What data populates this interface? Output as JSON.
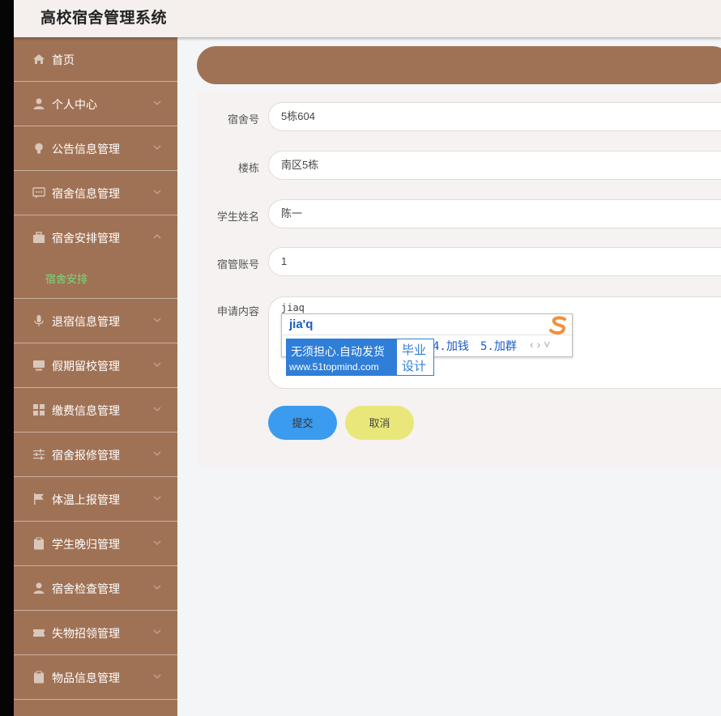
{
  "app": {
    "title": "高校宿舍管理系统"
  },
  "sidebar": {
    "items": [
      {
        "label": "首页",
        "icon": "home-icon",
        "chevron": false
      },
      {
        "label": "个人中心",
        "icon": "user-icon",
        "chevron": true
      },
      {
        "label": "公告信息管理",
        "icon": "bulb-icon",
        "chevron": true
      },
      {
        "label": "宿舍信息管理",
        "icon": "chat-icon",
        "chevron": true
      },
      {
        "label": "宿舍安排管理",
        "icon": "briefcase-icon",
        "chevron": true,
        "expanded": true
      },
      {
        "label": "退宿信息管理",
        "icon": "microphone-icon",
        "chevron": true
      },
      {
        "label": "假期留校管理",
        "icon": "monitor-icon",
        "chevron": true
      },
      {
        "label": "缴费信息管理",
        "icon": "grid-icon",
        "chevron": true
      },
      {
        "label": "宿舍报修管理",
        "icon": "sliders-icon",
        "chevron": true
      },
      {
        "label": "体温上报管理",
        "icon": "flag-icon",
        "chevron": true
      },
      {
        "label": "学生晚归管理",
        "icon": "clipboard-icon",
        "chevron": true
      },
      {
        "label": "宿舍检查管理",
        "icon": "user-icon",
        "chevron": true
      },
      {
        "label": "失物招领管理",
        "icon": "ticket-icon",
        "chevron": true
      },
      {
        "label": "物品信息管理",
        "icon": "clipboard-icon",
        "chevron": true
      }
    ],
    "sub_item": "宿舍安排",
    "accent_color": "#a07255",
    "active_color": "#7dd97a"
  },
  "form": {
    "dorm_no_label": "宿舍号",
    "dorm_no_value": "5栋604",
    "building_label": "楼栋",
    "building_value": "南区5栋",
    "student_label": "学生姓名",
    "student_value": "陈一",
    "manager_label": "宿管账号",
    "manager_value": "1",
    "content_label": "申请内容",
    "content_value": "jiaq",
    "submit_label": "提交",
    "cancel_label": "取消"
  },
  "ime": {
    "input": "jia'q",
    "cand4": "4.加钱",
    "cand5": "5.加群",
    "nav": "‹ › ˅"
  },
  "ad": {
    "line1": "无须担心.自动发货",
    "line2": "www.51topmind.com",
    "side1": "毕业",
    "side2": "设计"
  }
}
